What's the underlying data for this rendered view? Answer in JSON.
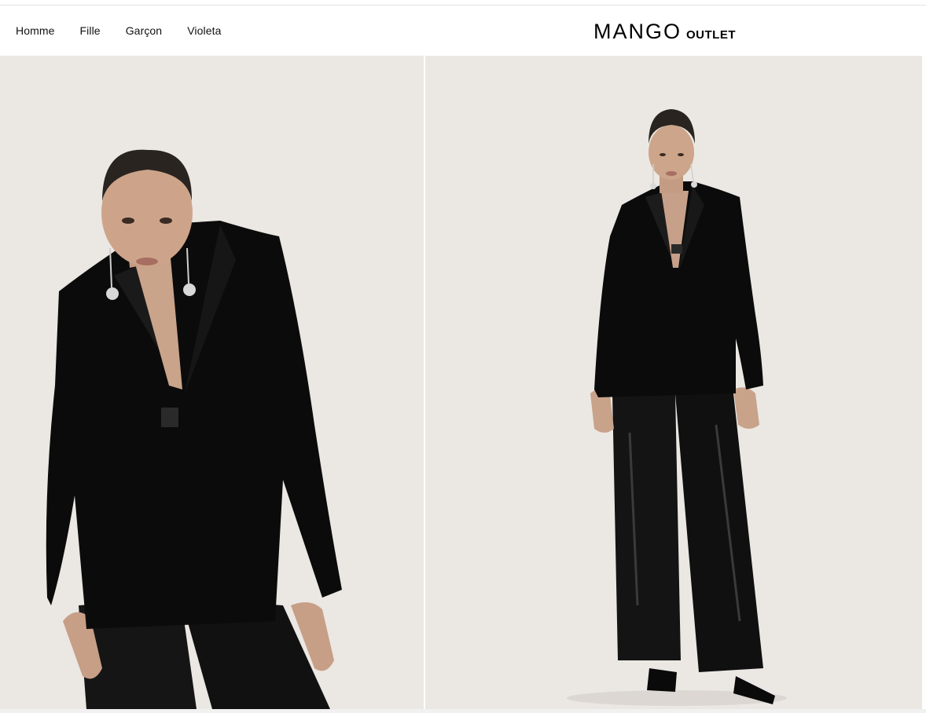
{
  "nav": {
    "items": [
      {
        "label": "Homme"
      },
      {
        "label": "Fille"
      },
      {
        "label": "Garçon"
      },
      {
        "label": "Violeta"
      }
    ]
  },
  "logo": {
    "main": "MANGO",
    "sub": "OUTLET"
  },
  "gallery": {
    "images": [
      {
        "subject": "model-closeup-velvet-blazer"
      },
      {
        "subject": "model-full-length-velvet-blazer-sequin-trousers"
      }
    ]
  },
  "colors": {
    "background": "#ffffff",
    "photo_backdrop": "#eae6e2",
    "garment": "#0b0b0b",
    "text": "#111111"
  }
}
